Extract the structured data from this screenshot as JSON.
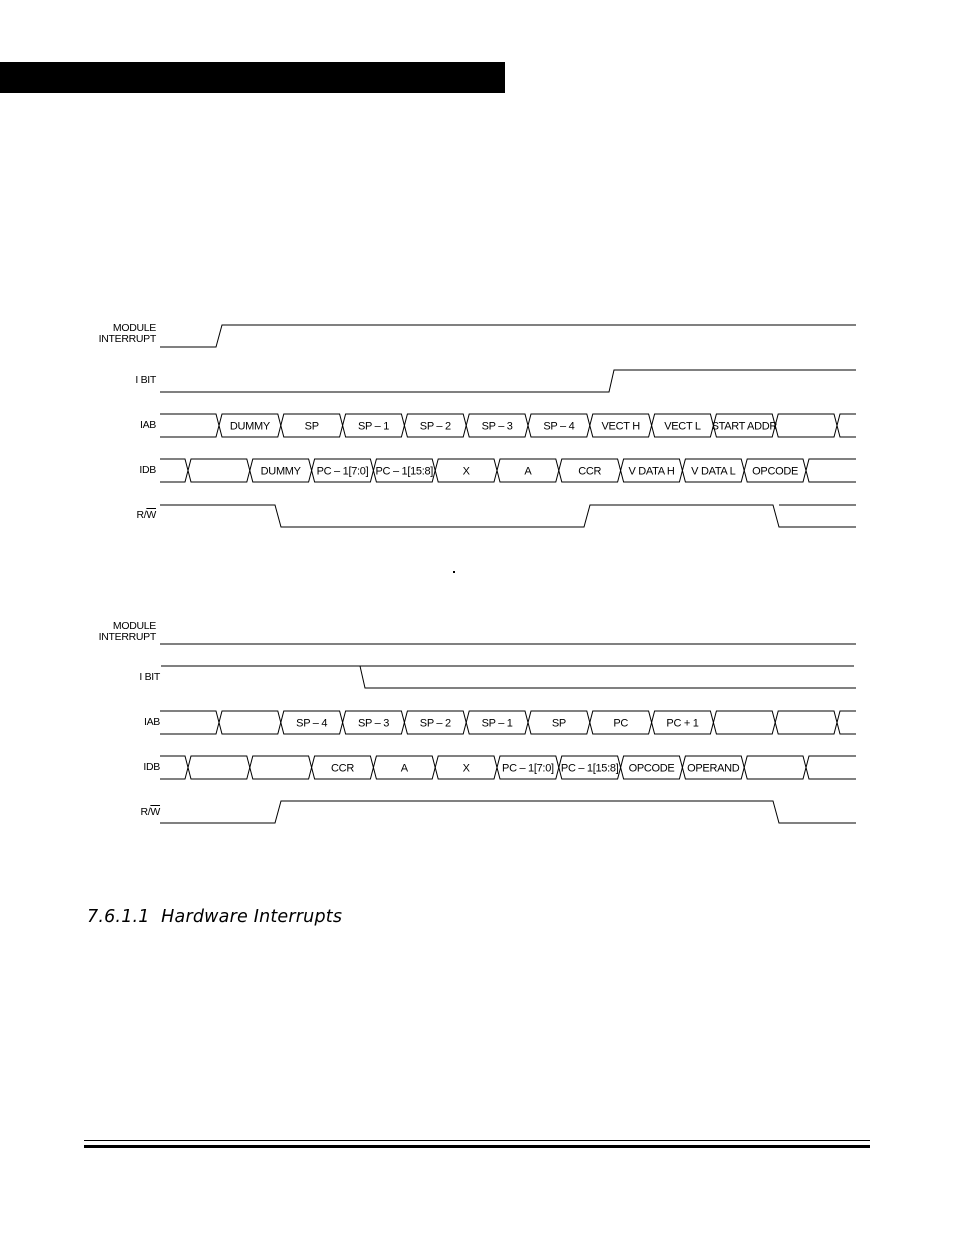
{
  "page": {
    "section_number": "7.6.1.1",
    "section_title": "Hardware Interrupts"
  },
  "diagrams": [
    {
      "id": "interrupt-entry",
      "signals": {
        "module_interrupt": {
          "label_line1": "MODULE",
          "label_line2": "INTERRUPT"
        },
        "i_bit": {
          "label": "I BIT"
        },
        "iab": {
          "label": "IAB",
          "cells": [
            "",
            "DUMMY",
            "SP",
            "SP – 1",
            "SP – 2",
            "SP – 3",
            "SP – 4",
            "VECT H",
            "VECT L",
            "START ADDR",
            "",
            ""
          ]
        },
        "idb": {
          "label": "IDB",
          "cells": [
            "",
            "",
            "DUMMY",
            "PC – 1[7:0]",
            "PC – 1[15:8]",
            "X",
            "A",
            "CCR",
            "V DATA H",
            "V DATA L",
            "OPCODE",
            ""
          ]
        },
        "rw": {
          "label": "R/",
          "label_overbar": "W"
        }
      }
    },
    {
      "id": "interrupt-return",
      "signals": {
        "module_interrupt": {
          "label_line1": "MODULE",
          "label_line2": "INTERRUPT"
        },
        "i_bit": {
          "label": "I BIT"
        },
        "iab": {
          "label": "IAB",
          "cells": [
            "",
            "",
            "SP – 4",
            "SP – 3",
            "SP – 2",
            "SP – 1",
            "SP",
            "PC",
            "PC + 1",
            "",
            "",
            ""
          ]
        },
        "idb": {
          "label": "IDB",
          "cells": [
            "",
            "",
            "",
            "CCR",
            "A",
            "X",
            "PC – 1[7:0]",
            "PC – 1[15:8]",
            "OPCODE",
            "OPERAND",
            "",
            ""
          ]
        },
        "rw": {
          "label": "R/",
          "label_overbar": "W"
        }
      }
    }
  ]
}
